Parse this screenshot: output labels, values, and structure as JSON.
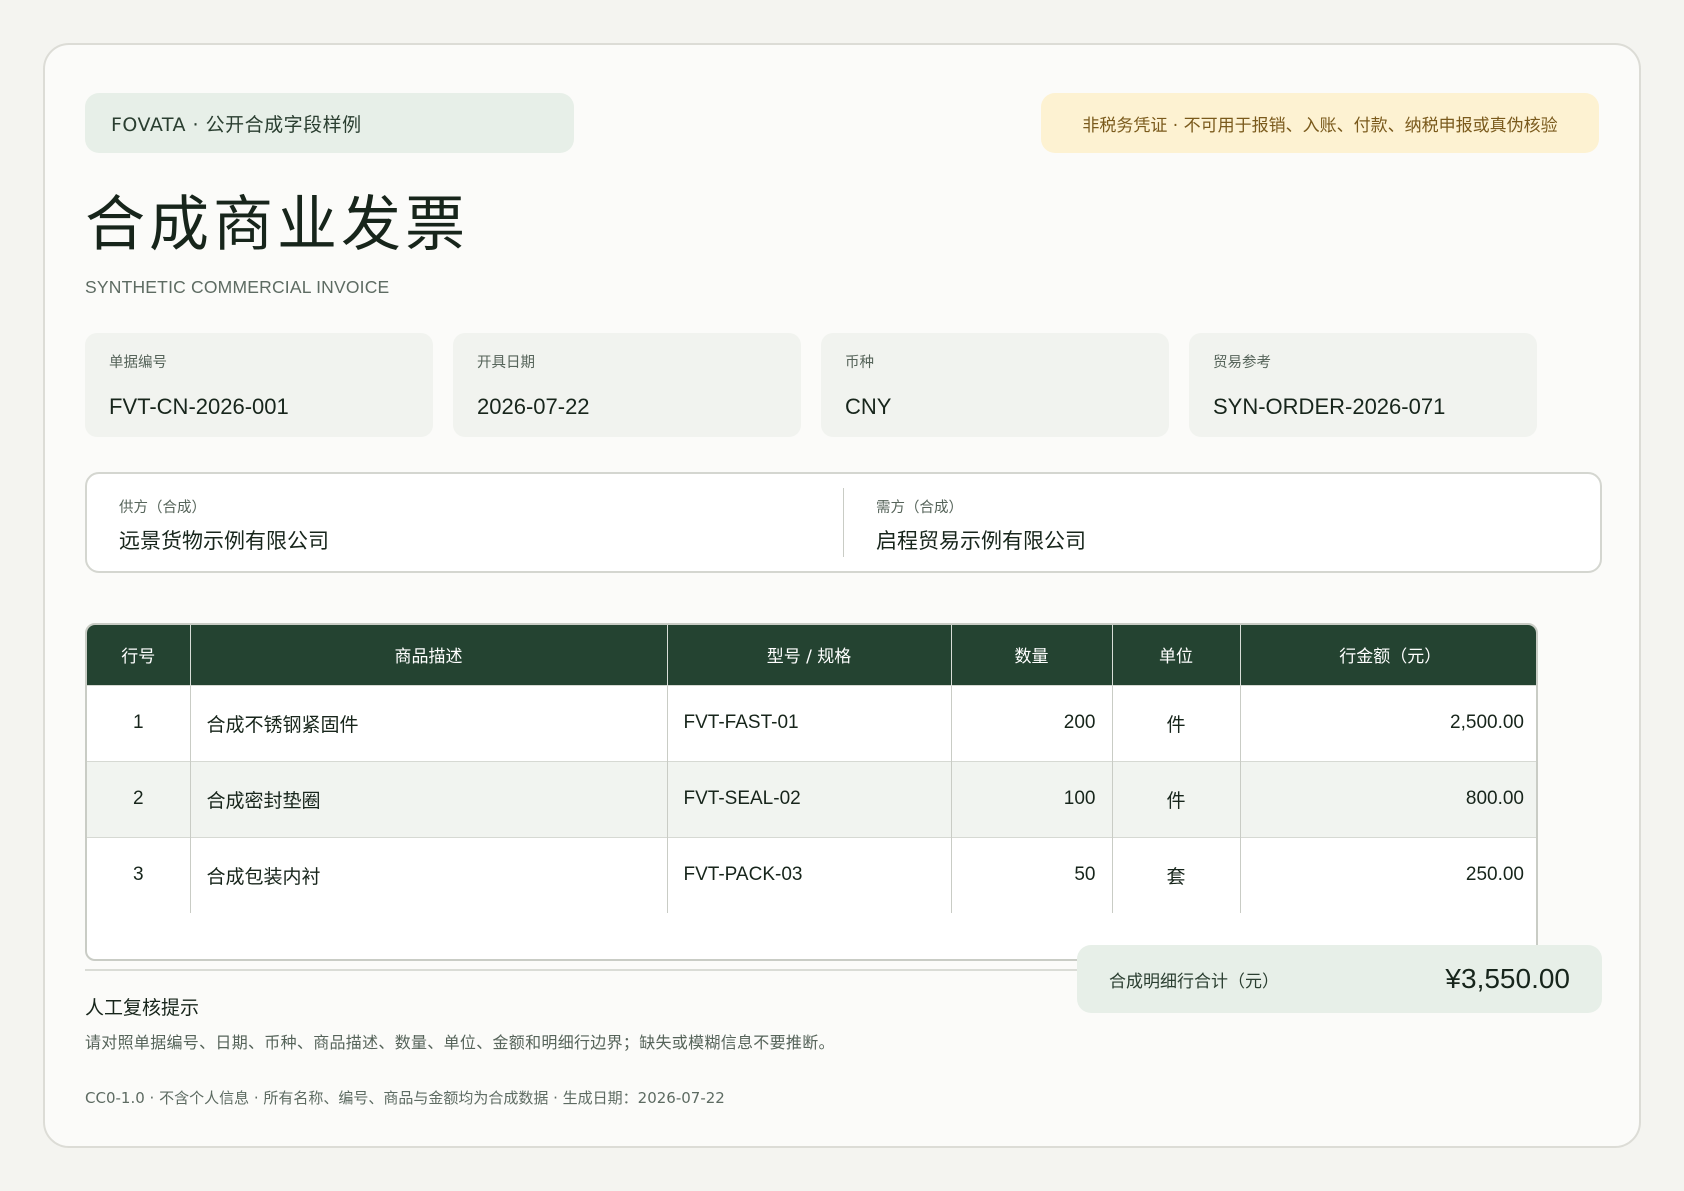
{
  "header": {
    "source_label": "FOVATA · 公开合成字段样例",
    "warning": "非税务凭证 · 不可用于报销、入账、付款、纳税申报或真伪核验",
    "title": "合成商业发票",
    "subtitle": "SYNTHETIC COMMERCIAL INVOICE"
  },
  "meta": [
    {
      "label": "单据编号",
      "value": "FVT-CN-2026-001"
    },
    {
      "label": "开具日期",
      "value": "2026-07-22"
    },
    {
      "label": "币种",
      "value": "CNY"
    },
    {
      "label": "贸易参考",
      "value": "SYN-ORDER-2026-071"
    }
  ],
  "parties": {
    "seller": {
      "label": "供方（合成）",
      "name": "远景货物示例有限公司"
    },
    "buyer": {
      "label": "需方（合成）",
      "name": "启程贸易示例有限公司"
    }
  },
  "table": {
    "headers": [
      "行号",
      "商品描述",
      "型号 / 规格",
      "数量",
      "单位",
      "行金额（元）"
    ],
    "rows": [
      [
        "1",
        "合成不锈钢紧固件",
        "FVT-FAST-01",
        "200",
        "件",
        "2,500.00"
      ],
      [
        "2",
        "合成密封垫圈",
        "FVT-SEAL-02",
        "100",
        "件",
        "800.00"
      ],
      [
        "3",
        "合成包装内衬",
        "FVT-PACK-03",
        "50",
        "套",
        "250.00"
      ]
    ]
  },
  "review": {
    "title": "人工复核提示",
    "text": "请对照单据编号、日期、币种、商品描述、数量、单位、金额和明细行边界；缺失或模糊信息不要推断。"
  },
  "total": {
    "label": "合成明细行合计（元）",
    "value": "¥3,550.00"
  },
  "footer": "CC0-1.0 · 不含个人信息 · 所有名称、编号、商品与金额均为合成数据 · 生成日期：2026-07-22"
}
